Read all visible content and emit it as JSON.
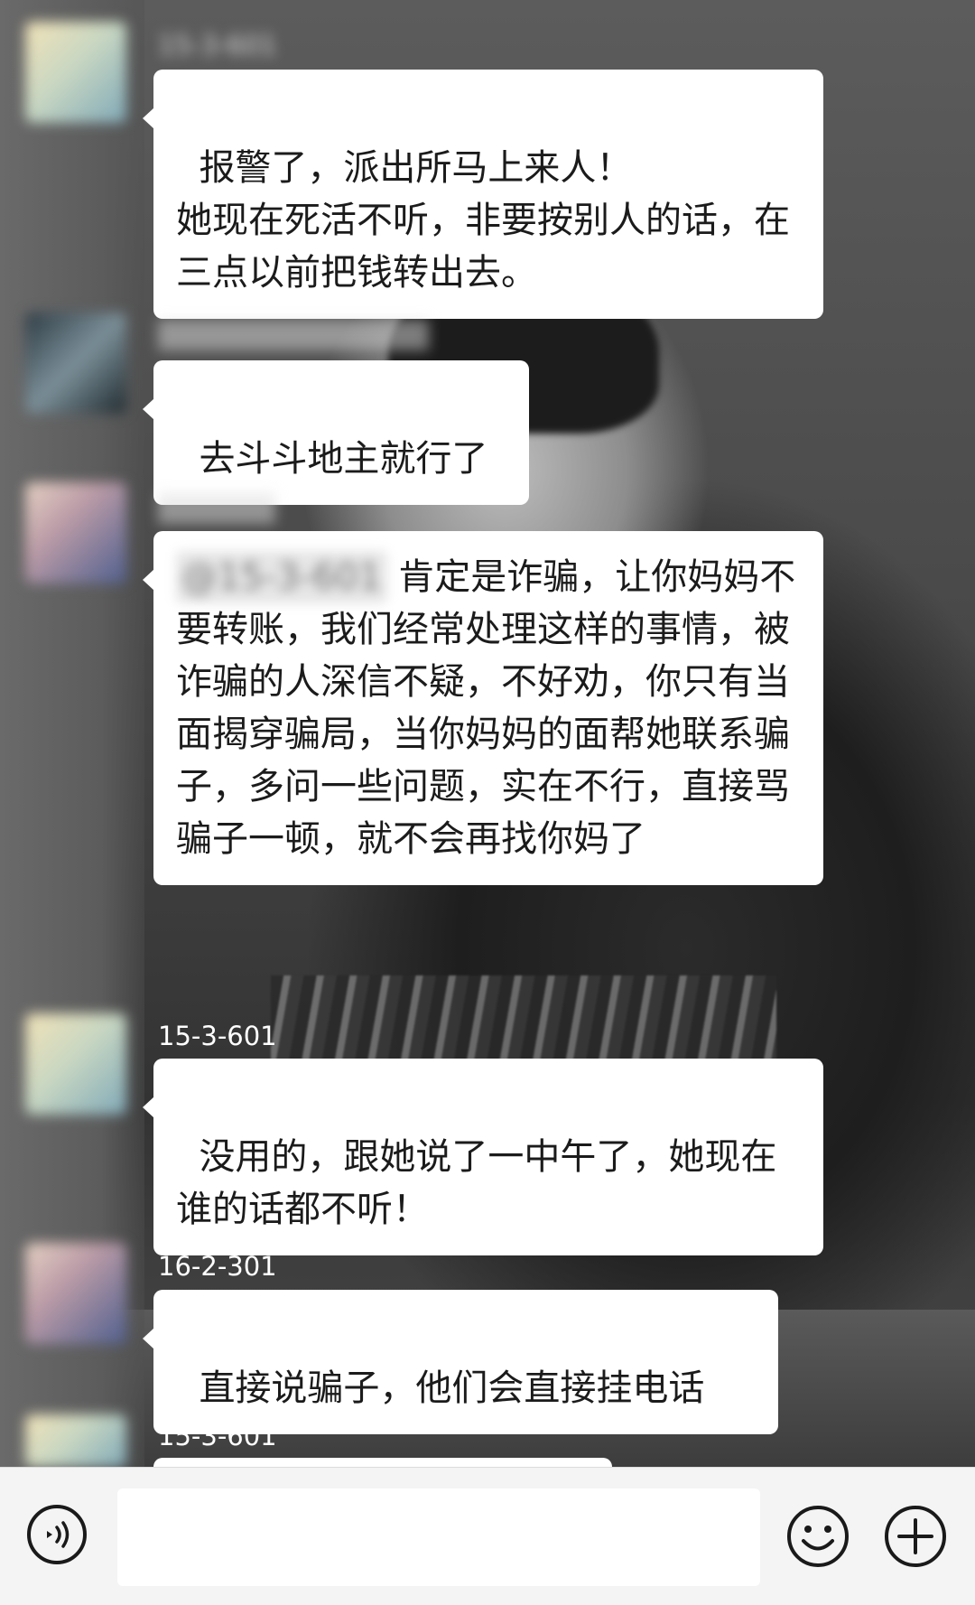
{
  "messages": [
    {
      "sender": "15-3-601",
      "sender_blurred": true,
      "text": "报警了，派出所马上来人！\n她现在死活不听，非要按别人的话，在三点以前把钱转出去。"
    },
    {
      "sender": "",
      "sender_blurred": true,
      "text": "去斗斗地主就行了"
    },
    {
      "sender": "",
      "sender_blurred": true,
      "mention": "@15-3-601",
      "text": " 肯定是诈骗，让你妈妈不要转账，我们经常处理这样的事情，被诈骗的人深信不疑，不好劝，你只有当面揭穿骗局，当你妈妈的面帮她联系骗子，多问一些问题，实在不行，直接骂骗子一顿，就不会再找你妈了"
    },
    {
      "sender": "15-3-601",
      "sender_blurred": false,
      "text": "没用的，跟她说了一中午了，她现在谁的话都不听！"
    },
    {
      "sender": "16-2-301",
      "sender_blurred": false,
      "text": "直接说骗子，他们会直接挂电话"
    },
    {
      "sender": "15-3-601",
      "sender_blurred": false,
      "text": ""
    }
  ],
  "input_bar": {
    "voice_icon": "voice-icon",
    "input_value": "",
    "emoji_icon": "emoji-icon",
    "plus_icon": "plus-icon"
  }
}
